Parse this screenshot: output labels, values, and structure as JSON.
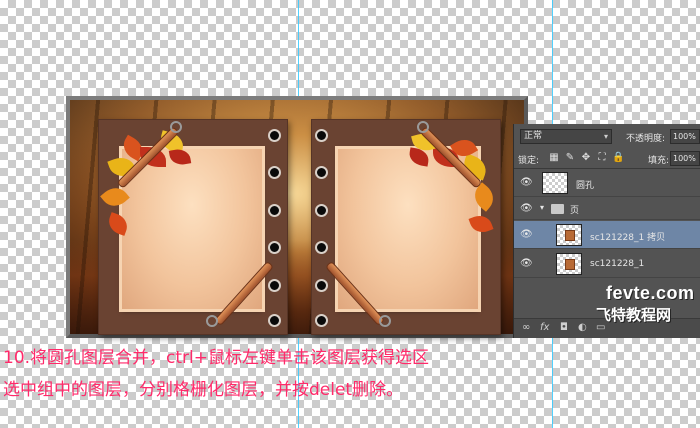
{
  "layers_panel": {
    "blend_mode": "正常",
    "opacity_label": "不透明度:",
    "opacity_value": "100%",
    "lock_label": "锁定:",
    "fill_label": "填充:",
    "fill_value": "100%",
    "layers": [
      {
        "name": "圆孔",
        "type": "layer",
        "selected": false
      },
      {
        "name": "页",
        "type": "group",
        "selected": false
      },
      {
        "name": "sc121228_1 拷贝",
        "type": "layer",
        "selected": true
      },
      {
        "name": "sc121228_1",
        "type": "layer",
        "selected": false
      }
    ],
    "footer_icons": [
      "link-icon",
      "fx-icon",
      "mask-icon",
      "adjustment-icon",
      "folder-icon",
      "new-layer-icon",
      "trash-icon"
    ]
  },
  "watermark": {
    "domain": "fevte.com",
    "brand": "飞特教程网"
  },
  "instructions": {
    "line1": "10.将圆孔图层合并，ctrl+鼠标左键单击该图层获得选区",
    "line2": "选中组中的图层，分别格栅化图层，并按delet删除。"
  },
  "colors": {
    "instruction_text": "#ff2a6a",
    "selected_layer": "#6e86a6",
    "panel_bg": "#535353",
    "guide": "#33c9ff"
  }
}
